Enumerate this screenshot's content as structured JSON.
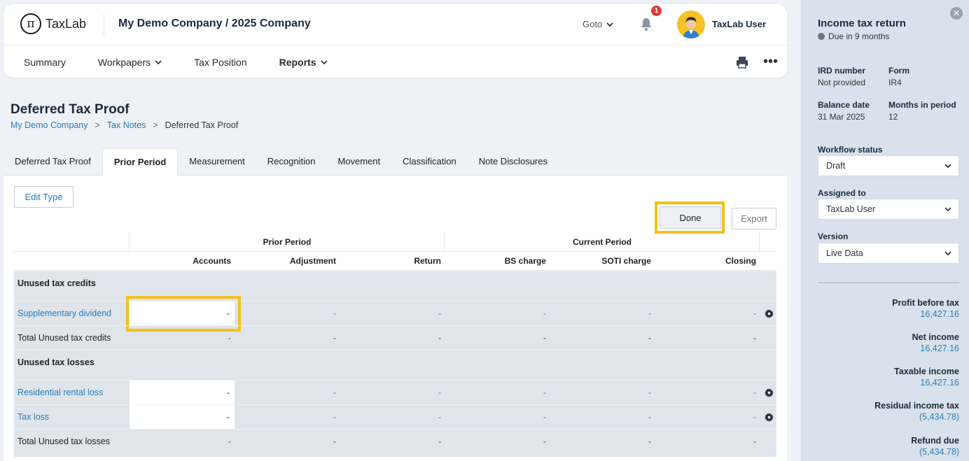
{
  "app": {
    "logo_text": "TaxLab",
    "company": "My Demo Company / 2025 Company",
    "goto_label": "Goto",
    "notification_count": "1",
    "username": "TaxLab User"
  },
  "nav": {
    "items": [
      "Summary",
      "Workpapers",
      "Tax Position",
      "Reports"
    ]
  },
  "page": {
    "title": "Deferred Tax Proof",
    "breadcrumb": [
      "My Demo Company",
      "Tax Notes",
      "Deferred Tax Proof"
    ],
    "tabs": [
      "Deferred Tax Proof",
      "Prior Period",
      "Measurement",
      "Recognition",
      "Movement",
      "Classification",
      "Note Disclosures"
    ],
    "active_tab": "Prior Period"
  },
  "toolbar": {
    "edit_type": "Edit Type",
    "done": "Done",
    "export": "Export"
  },
  "table": {
    "groups": [
      "Prior Period",
      "Current Period"
    ],
    "columns": [
      "Accounts",
      "Adjustment",
      "Return",
      "BS charge",
      "SOTI charge",
      "Closing"
    ],
    "sections": [
      {
        "title": "Unused tax credits",
        "rows": [
          {
            "label": "Supplementary dividend",
            "values": [
              "-",
              "-",
              "-",
              "-",
              "-",
              "-"
            ]
          }
        ],
        "total": {
          "label": "Total Unused tax credits",
          "values": [
            "-",
            "-",
            "-",
            "-",
            "-",
            "-"
          ]
        }
      },
      {
        "title": "Unused tax losses",
        "rows": [
          {
            "label": "Residential rental loss",
            "values": [
              "-",
              "-",
              "-",
              "-",
              "-",
              "-"
            ]
          },
          {
            "label": "Tax loss",
            "values": [
              "-",
              "-",
              "-",
              "-",
              "-",
              "-"
            ]
          }
        ],
        "total": {
          "label": "Total Unused tax losses",
          "values": [
            "-",
            "-",
            "-",
            "-",
            "-",
            "-"
          ]
        }
      }
    ]
  },
  "panel": {
    "title": "Income tax return",
    "due": "Due in 9 months",
    "ird_label": "IRD number",
    "ird_value": "Not provided",
    "form_label": "Form",
    "form_value": "IR4",
    "balance_label": "Balance date",
    "balance_value": "31 Mar 2025",
    "months_label": "Months in period",
    "months_value": "12",
    "workflow_label": "Workflow status",
    "workflow_value": "Draft",
    "assigned_label": "Assigned to",
    "assigned_value": "TaxLab User",
    "version_label": "Version",
    "version_value": "Live Data",
    "metrics": [
      {
        "label": "Profit before tax",
        "value": "16,427.16"
      },
      {
        "label": "Net income",
        "value": "16,427.16"
      },
      {
        "label": "Taxable income",
        "value": "16,427.16"
      },
      {
        "label": "Residual income tax",
        "value": "(5,434.78)"
      },
      {
        "label": "Refund due",
        "value": "(5,434.78)"
      }
    ]
  },
  "colors": {
    "accent": "#2b7bb9",
    "highlight": "#f2c11b",
    "panel_bg": "#d9e2ec",
    "table_bg": "#dfe5eb",
    "badge": "#e03a3a"
  }
}
